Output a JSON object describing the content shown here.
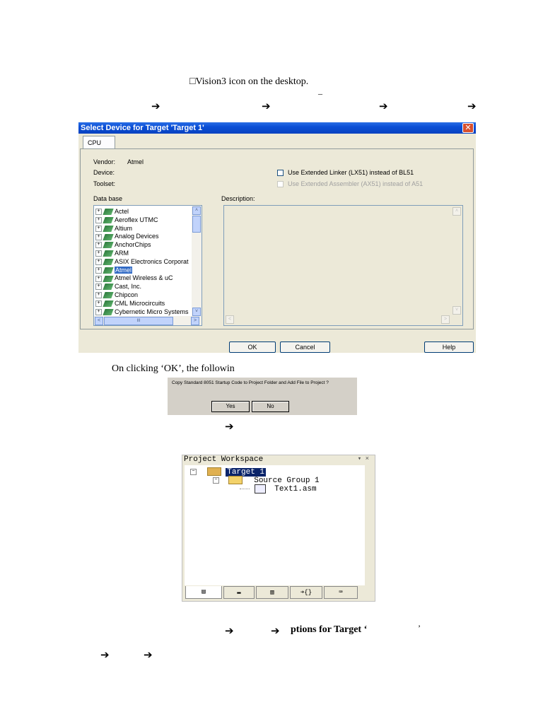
{
  "doc": {
    "line1": "□Vision3 icon on the desktop.",
    "dash1": "–",
    "arrow": "➔",
    "caption_ok": "On clicking ‘OK’, the followin",
    "bottom_text": "ptions for Target ‘",
    "bottom_quote": "’"
  },
  "select_device_dialog": {
    "title": "Select Device for Target 'Target 1'",
    "close_glyph": "✕",
    "tab": "CPU",
    "vendor_label": "Vendor:",
    "vendor_value": "Atmel",
    "device_label": "Device:",
    "toolset_label": "Toolset:",
    "database_label": "Data base",
    "description_label": "Description:",
    "use_lx51": "Use Extended Linker (LX51) instead of BL51",
    "use_ax51": "Use Extended Assembler (AX51) instead of A51",
    "vendors": [
      "Actel",
      "Aeroflex UTMC",
      "Altium",
      "Analog Devices",
      "AnchorChips",
      "ARM",
      "ASIX Electronics Corporat",
      "Atmel",
      "Atmel Wireless & uC",
      "Cast, Inc.",
      "Chipcon",
      "CML Microcircuits",
      "Cybernetic Micro Systems"
    ],
    "selected_vendor": "Atmel",
    "ok_label": "OK",
    "cancel_label": "Cancel",
    "help_label": "Help",
    "scroll_up": "˄",
    "scroll_down": "˅",
    "scroll_left": "<",
    "scroll_right": ">",
    "scroll_thumb": "III",
    "tree_expander": "+"
  },
  "copy_dialog": {
    "message": "Copy Standard 8051 Startup Code to Project Folder and Add File to Project ?",
    "yes_label": "Yes",
    "no_label": "No"
  },
  "workspace": {
    "title": "Project Workspace",
    "controls": "▾ ×",
    "target": "Target 1",
    "group": "Source Group 1",
    "file": "Text1.asm",
    "collapse_glyph": "−",
    "tab_icons": [
      "▤",
      "▬",
      "▥",
      "➔{}",
      "⌨"
    ]
  }
}
